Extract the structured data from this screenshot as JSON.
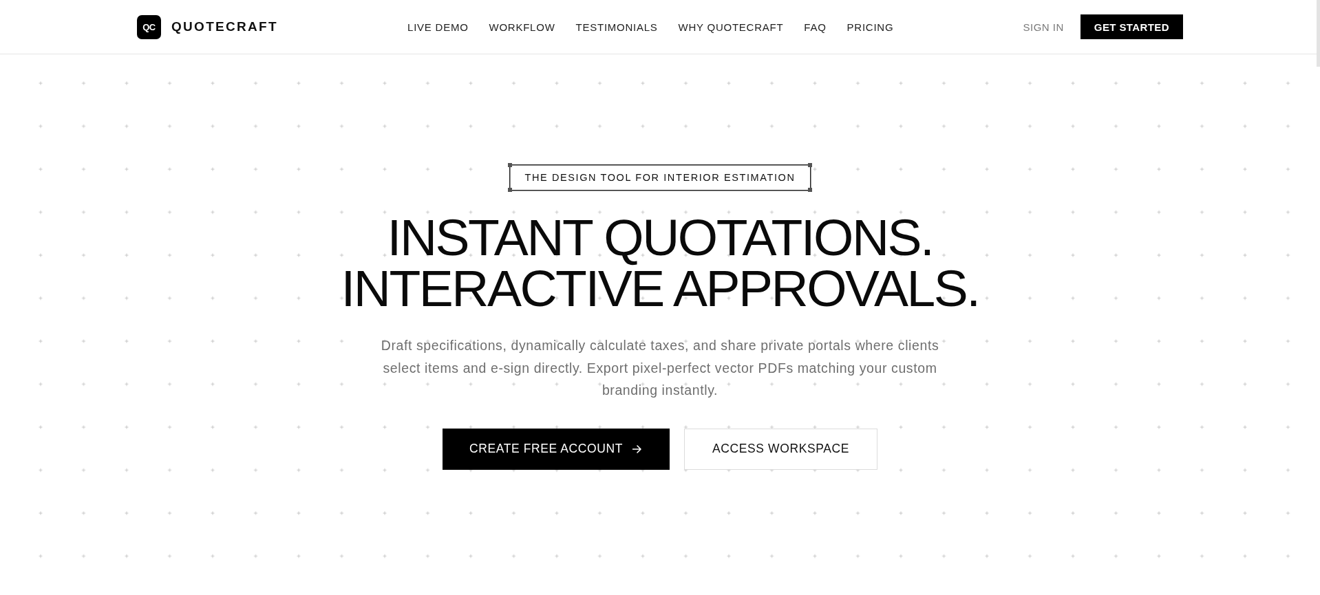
{
  "brand": {
    "logo_mark": "QC",
    "name": "QUOTECRAFT"
  },
  "nav": [
    {
      "label": "LIVE DEMO"
    },
    {
      "label": "WORKFLOW"
    },
    {
      "label": "TESTIMONIALS"
    },
    {
      "label": "WHY QUOTECRAFT"
    },
    {
      "label": "FAQ"
    },
    {
      "label": "PRICING"
    }
  ],
  "auth": {
    "sign_in": "SIGN IN",
    "get_started": "GET STARTED"
  },
  "hero": {
    "badge": "THE DESIGN TOOL FOR INTERIOR ESTIMATION",
    "headline": [
      "INSTANT QUOTATIONS.",
      "INTERACTIVE APPROVALS."
    ],
    "description": "Draft specifications, dynamically calculate taxes, and share private portals where clients select items and e-sign directly. Export pixel-perfect vector PDFs matching your custom branding instantly.",
    "buttons": [
      {
        "label": "CREATE FREE ACCOUNT",
        "kind": "primary"
      },
      {
        "label": "ACCESS WORKSPACE",
        "kind": "secondary"
      }
    ]
  }
}
